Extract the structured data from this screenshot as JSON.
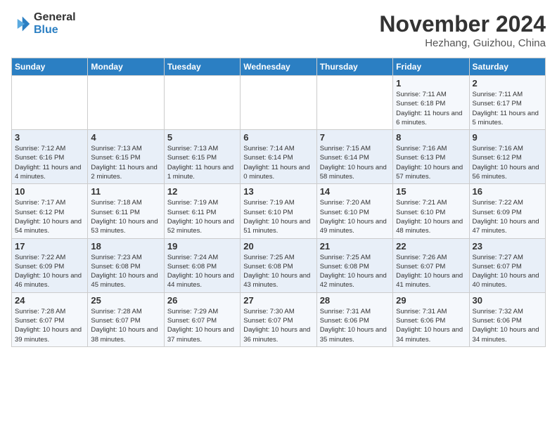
{
  "logo": {
    "general": "General",
    "blue": "Blue"
  },
  "header": {
    "month": "November 2024",
    "location": "Hezhang, Guizhou, China"
  },
  "days_of_week": [
    "Sunday",
    "Monday",
    "Tuesday",
    "Wednesday",
    "Thursday",
    "Friday",
    "Saturday"
  ],
  "weeks": [
    [
      {
        "day": "",
        "info": ""
      },
      {
        "day": "",
        "info": ""
      },
      {
        "day": "",
        "info": ""
      },
      {
        "day": "",
        "info": ""
      },
      {
        "day": "",
        "info": ""
      },
      {
        "day": "1",
        "info": "Sunrise: 7:11 AM\nSunset: 6:18 PM\nDaylight: 11 hours and 6 minutes."
      },
      {
        "day": "2",
        "info": "Sunrise: 7:11 AM\nSunset: 6:17 PM\nDaylight: 11 hours and 5 minutes."
      }
    ],
    [
      {
        "day": "3",
        "info": "Sunrise: 7:12 AM\nSunset: 6:16 PM\nDaylight: 11 hours and 4 minutes."
      },
      {
        "day": "4",
        "info": "Sunrise: 7:13 AM\nSunset: 6:15 PM\nDaylight: 11 hours and 2 minutes."
      },
      {
        "day": "5",
        "info": "Sunrise: 7:13 AM\nSunset: 6:15 PM\nDaylight: 11 hours and 1 minute."
      },
      {
        "day": "6",
        "info": "Sunrise: 7:14 AM\nSunset: 6:14 PM\nDaylight: 11 hours and 0 minutes."
      },
      {
        "day": "7",
        "info": "Sunrise: 7:15 AM\nSunset: 6:14 PM\nDaylight: 10 hours and 58 minutes."
      },
      {
        "day": "8",
        "info": "Sunrise: 7:16 AM\nSunset: 6:13 PM\nDaylight: 10 hours and 57 minutes."
      },
      {
        "day": "9",
        "info": "Sunrise: 7:16 AM\nSunset: 6:12 PM\nDaylight: 10 hours and 56 minutes."
      }
    ],
    [
      {
        "day": "10",
        "info": "Sunrise: 7:17 AM\nSunset: 6:12 PM\nDaylight: 10 hours and 54 minutes."
      },
      {
        "day": "11",
        "info": "Sunrise: 7:18 AM\nSunset: 6:11 PM\nDaylight: 10 hours and 53 minutes."
      },
      {
        "day": "12",
        "info": "Sunrise: 7:19 AM\nSunset: 6:11 PM\nDaylight: 10 hours and 52 minutes."
      },
      {
        "day": "13",
        "info": "Sunrise: 7:19 AM\nSunset: 6:10 PM\nDaylight: 10 hours and 51 minutes."
      },
      {
        "day": "14",
        "info": "Sunrise: 7:20 AM\nSunset: 6:10 PM\nDaylight: 10 hours and 49 minutes."
      },
      {
        "day": "15",
        "info": "Sunrise: 7:21 AM\nSunset: 6:10 PM\nDaylight: 10 hours and 48 minutes."
      },
      {
        "day": "16",
        "info": "Sunrise: 7:22 AM\nSunset: 6:09 PM\nDaylight: 10 hours and 47 minutes."
      }
    ],
    [
      {
        "day": "17",
        "info": "Sunrise: 7:22 AM\nSunset: 6:09 PM\nDaylight: 10 hours and 46 minutes."
      },
      {
        "day": "18",
        "info": "Sunrise: 7:23 AM\nSunset: 6:08 PM\nDaylight: 10 hours and 45 minutes."
      },
      {
        "day": "19",
        "info": "Sunrise: 7:24 AM\nSunset: 6:08 PM\nDaylight: 10 hours and 44 minutes."
      },
      {
        "day": "20",
        "info": "Sunrise: 7:25 AM\nSunset: 6:08 PM\nDaylight: 10 hours and 43 minutes."
      },
      {
        "day": "21",
        "info": "Sunrise: 7:25 AM\nSunset: 6:08 PM\nDaylight: 10 hours and 42 minutes."
      },
      {
        "day": "22",
        "info": "Sunrise: 7:26 AM\nSunset: 6:07 PM\nDaylight: 10 hours and 41 minutes."
      },
      {
        "day": "23",
        "info": "Sunrise: 7:27 AM\nSunset: 6:07 PM\nDaylight: 10 hours and 40 minutes."
      }
    ],
    [
      {
        "day": "24",
        "info": "Sunrise: 7:28 AM\nSunset: 6:07 PM\nDaylight: 10 hours and 39 minutes."
      },
      {
        "day": "25",
        "info": "Sunrise: 7:28 AM\nSunset: 6:07 PM\nDaylight: 10 hours and 38 minutes."
      },
      {
        "day": "26",
        "info": "Sunrise: 7:29 AM\nSunset: 6:07 PM\nDaylight: 10 hours and 37 minutes."
      },
      {
        "day": "27",
        "info": "Sunrise: 7:30 AM\nSunset: 6:07 PM\nDaylight: 10 hours and 36 minutes."
      },
      {
        "day": "28",
        "info": "Sunrise: 7:31 AM\nSunset: 6:06 PM\nDaylight: 10 hours and 35 minutes."
      },
      {
        "day": "29",
        "info": "Sunrise: 7:31 AM\nSunset: 6:06 PM\nDaylight: 10 hours and 34 minutes."
      },
      {
        "day": "30",
        "info": "Sunrise: 7:32 AM\nSunset: 6:06 PM\nDaylight: 10 hours and 34 minutes."
      }
    ]
  ]
}
